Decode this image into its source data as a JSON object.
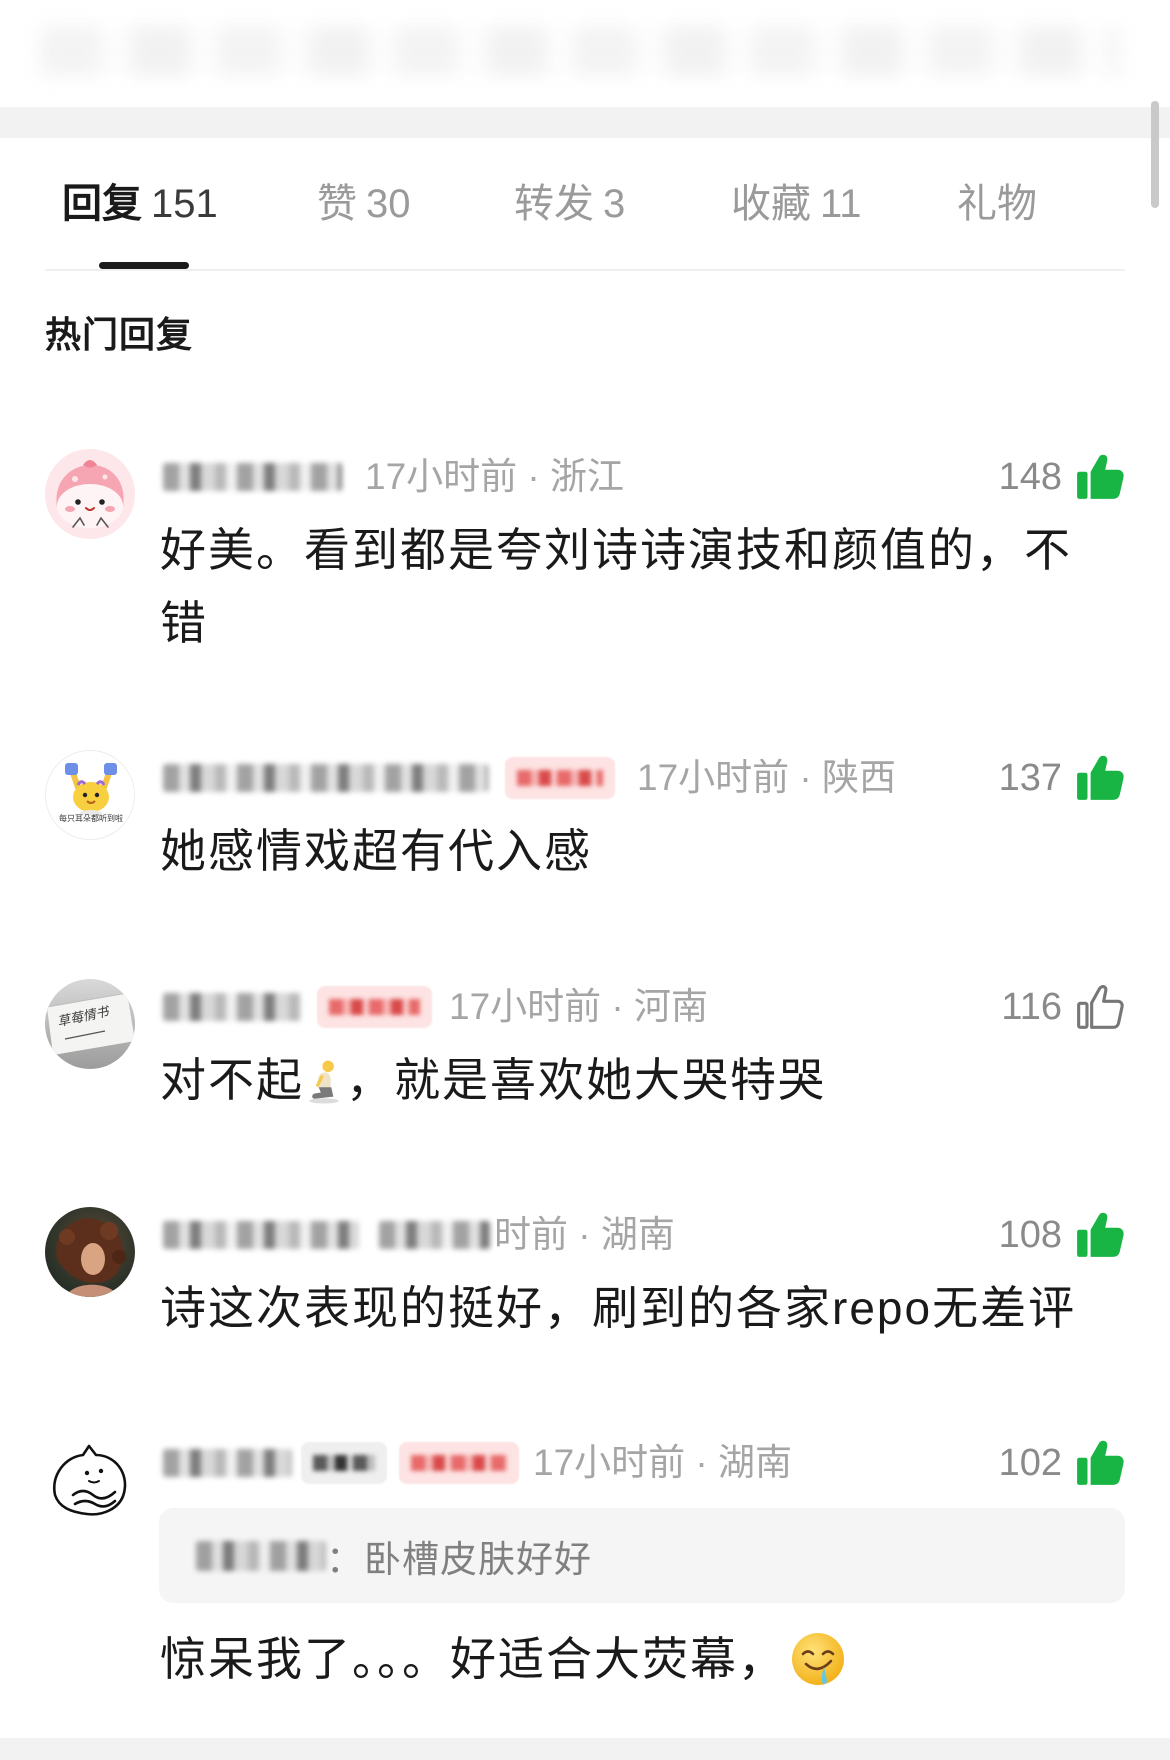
{
  "tabs": [
    {
      "label": "回复",
      "count": "151",
      "active": true
    },
    {
      "label": "赞",
      "count": "30",
      "active": false
    },
    {
      "label": "转发",
      "count": "3",
      "active": false
    },
    {
      "label": "收藏",
      "count": "11",
      "active": false
    },
    {
      "label": "礼物",
      "count": "",
      "active": false
    }
  ],
  "section_title": "热门回复",
  "comments": [
    {
      "avatar": "pink-cartoon-avatar",
      "time_location": "17小时前 · 浙江",
      "likes": "148",
      "liked": true,
      "text": "好美。看到都是夸刘诗诗演技和颜值的，不错"
    },
    {
      "avatar": "yellow-cartoon-avatar",
      "avatar_caption": "每只耳朵都听到啦",
      "time_location": "17小时前 · 陕西",
      "likes": "137",
      "liked": true,
      "text": "她感情戏超有代入感"
    },
    {
      "avatar": "handwritten-note-photo-avatar",
      "avatar_caption": "草莓情书",
      "time_location": "17小时前 · 河南",
      "likes": "116",
      "liked": false,
      "text_before": "对不起",
      "emoji": "kneeling-person-emoji",
      "text_after": "，就是喜欢她大哭特哭"
    },
    {
      "avatar": "curly-hair-photo-avatar",
      "time_location": "时前 · 湖南",
      "likes": "108",
      "liked": true,
      "text": "诗这次表现的挺好，刷到的各家repo无差评"
    },
    {
      "avatar": "line-drawing-cartoon-avatar",
      "time_location": "17小时前 · 湖南",
      "likes": "102",
      "liked": true,
      "quote": {
        "text": "：卧槽皮肤好好"
      },
      "text_before": "惊呆我了。。。好适合大荧幕，",
      "emoji": "drooling-face-emoji"
    }
  ],
  "colors": {
    "like_active": "#19b544",
    "like_inactive": "#777777",
    "text_primary": "#1a1a1a",
    "text_secondary": "#a5a5a5",
    "background_band": "#f2f2f2"
  }
}
